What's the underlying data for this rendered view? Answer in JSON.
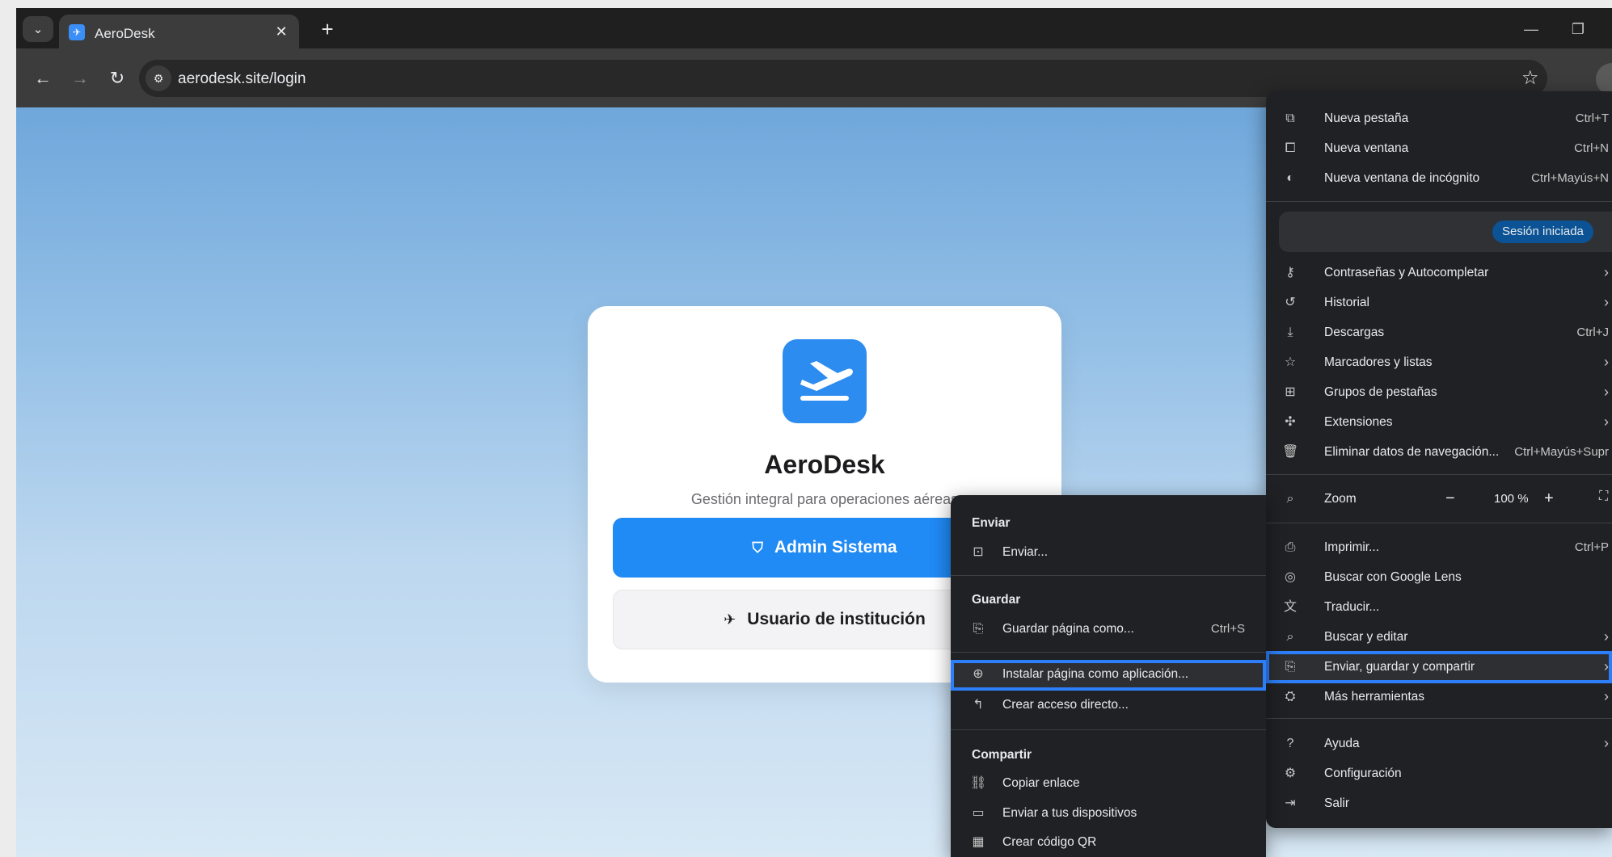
{
  "browser": {
    "tab_title": "AeroDesk",
    "url": "aerodesk.site/login"
  },
  "page": {
    "title": "AeroDesk",
    "subtitle": "Gestión integral para operaciones aéreas",
    "admin_button": "Admin Sistema",
    "user_button": "Usuario de institución"
  },
  "main_menu": {
    "new_tab": {
      "label": "Nueva pestaña",
      "shortcut": "Ctrl+T"
    },
    "new_window": {
      "label": "Nueva ventana",
      "shortcut": "Ctrl+N"
    },
    "incognito": {
      "label": "Nueva ventana de incógnito",
      "shortcut": "Ctrl+Mayús+N"
    },
    "signed_in": "Sesión iniciada",
    "passwords": {
      "label": "Contraseñas y Autocompletar"
    },
    "history": {
      "label": "Historial"
    },
    "downloads": {
      "label": "Descargas",
      "shortcut": "Ctrl+J"
    },
    "bookmarks": {
      "label": "Marcadores y listas"
    },
    "tab_groups": {
      "label": "Grupos de pestañas"
    },
    "extensions": {
      "label": "Extensiones"
    },
    "clear_data": {
      "label": "Eliminar datos de navegación...",
      "shortcut": "Ctrl+Mayús+Supr"
    },
    "zoom": {
      "label": "Zoom",
      "value": "100 %"
    },
    "print": {
      "label": "Imprimir...",
      "shortcut": "Ctrl+P"
    },
    "google_lens": {
      "label": "Buscar con Google Lens"
    },
    "translate": {
      "label": "Traducir..."
    },
    "find_edit": {
      "label": "Buscar y editar"
    },
    "save_share": {
      "label": "Enviar, guardar y compartir"
    },
    "more_tools": {
      "label": "Más herramientas"
    },
    "help": {
      "label": "Ayuda"
    },
    "settings": {
      "label": "Configuración"
    },
    "exit": {
      "label": "Salir"
    }
  },
  "sub_menu": {
    "send_heading": "Enviar",
    "cast": "Enviar...",
    "save_heading": "Guardar",
    "save_page": {
      "label": "Guardar página como...",
      "shortcut": "Ctrl+S"
    },
    "install_app": "Instalar página como aplicación...",
    "create_shortcut": "Crear acceso directo...",
    "share_heading": "Compartir",
    "copy_link": "Copiar enlace",
    "send_devices": "Enviar a tus dispositivos",
    "qr_code": "Crear código QR"
  }
}
